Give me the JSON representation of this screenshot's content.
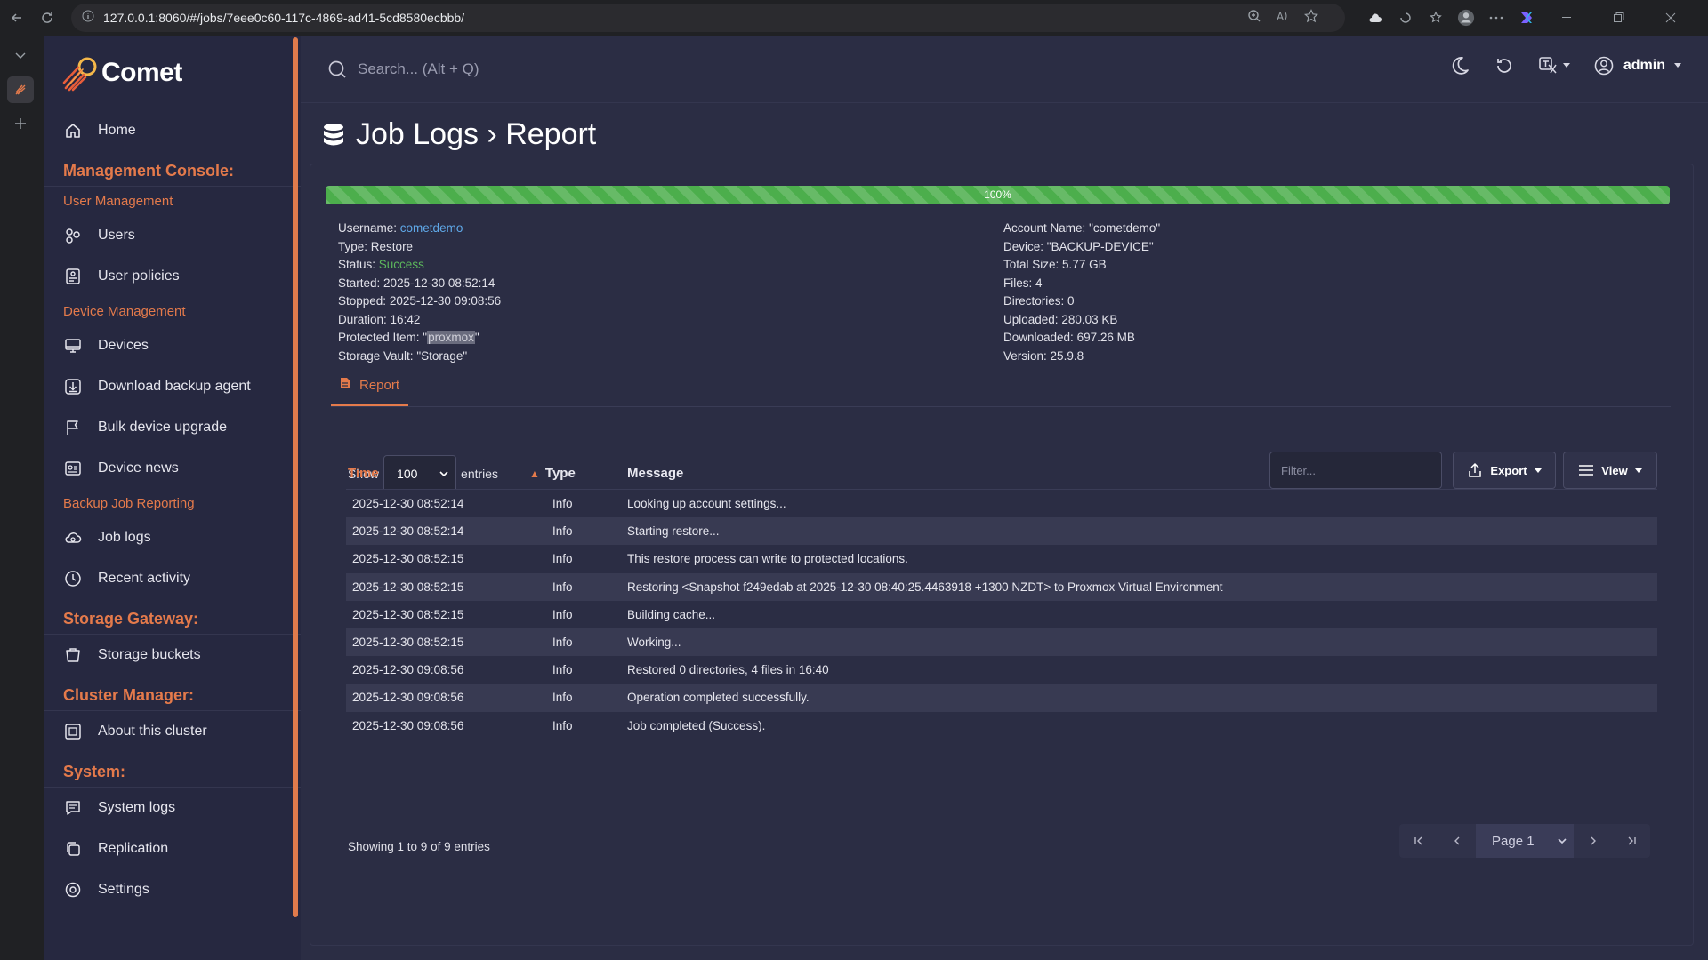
{
  "browser": {
    "url": "127.0.0.1:8060/#/jobs/7eee0c60-117c-4869-ad41-5cd8580ecbbb/"
  },
  "brand": {
    "name": "Comet"
  },
  "sidebar": {
    "home": "Home",
    "management_console": "Management Console:",
    "user_management": "User Management",
    "users": "Users",
    "user_policies": "User policies",
    "device_management": "Device Management",
    "devices": "Devices",
    "download_backup_agent": "Download backup agent",
    "bulk_device_upgrade": "Bulk device upgrade",
    "device_news": "Device news",
    "backup_job_reporting": "Backup Job Reporting",
    "job_logs": "Job logs",
    "recent_activity": "Recent activity",
    "storage_gateway": "Storage Gateway:",
    "storage_buckets": "Storage buckets",
    "cluster_manager": "Cluster Manager:",
    "about_cluster": "About this cluster",
    "system": "System:",
    "system_logs": "System logs",
    "replication": "Replication",
    "settings": "Settings"
  },
  "topbar": {
    "search_placeholder": "Search... (Alt + Q)",
    "user": "admin"
  },
  "page": {
    "title": "Job Logs › Report"
  },
  "progress": {
    "value": 1.0,
    "label": "100%"
  },
  "job": {
    "username_label": "Username:",
    "username": "cometdemo",
    "type_label": "Type:",
    "type": "Restore",
    "status_label": "Status:",
    "status": "Success",
    "started_label": "Started:",
    "started": "2025-12-30 08:52:14",
    "stopped_label": "Stopped:",
    "stopped": "2025-12-30 09:08:56",
    "duration_label": "Duration:",
    "duration": "16:42",
    "protected_item_label": "Protected Item:",
    "protected_item": "proxmox",
    "storage_vault_label": "Storage Vault:",
    "storage_vault": "\"Storage\"",
    "account_name_label": "Account Name:",
    "account_name": "\"cometdemo\"",
    "device_label": "Device:",
    "device": "\"BACKUP-DEVICE\"",
    "total_size_label": "Total Size:",
    "total_size": "5.77 GB",
    "files_label": "Files:",
    "files": "4",
    "directories_label": "Directories:",
    "directories": "0",
    "uploaded_label": "Uploaded:",
    "uploaded": "280.03 KB",
    "downloaded_label": "Downloaded:",
    "downloaded": "697.26 MB",
    "version_label": "Version:",
    "version": "25.9.8"
  },
  "tabs": {
    "report": "Report"
  },
  "table_controls": {
    "show": "Show",
    "page_size": "100",
    "entries": "entries",
    "filter_placeholder": "Filter...",
    "export": "Export",
    "view": "View"
  },
  "table": {
    "columns": [
      "Time",
      "Type",
      "Message"
    ],
    "rows": [
      [
        "2025-12-30 08:52:14",
        "Info",
        "Looking up account settings..."
      ],
      [
        "2025-12-30 08:52:14",
        "Info",
        "Starting restore..."
      ],
      [
        "2025-12-30 08:52:15",
        "Info",
        "This restore process can write to protected locations."
      ],
      [
        "2025-12-30 08:52:15",
        "Info",
        "Restoring <Snapshot f249edab at 2025-12-30 08:40:25.4463918 +1300 NZDT> to Proxmox Virtual Environment"
      ],
      [
        "2025-12-30 08:52:15",
        "Info",
        "Building cache..."
      ],
      [
        "2025-12-30 08:52:15",
        "Info",
        "Working..."
      ],
      [
        "2025-12-30 09:08:56",
        "Info",
        "Restored 0 directories, 4 files in 16:40"
      ],
      [
        "2025-12-30 09:08:56",
        "Info",
        "Operation completed successfully."
      ],
      [
        "2025-12-30 09:08:56",
        "Info",
        "Job completed (Success)."
      ]
    ]
  },
  "footer": {
    "showing": "Showing 1 to 9 of 9 entries",
    "page": "Page 1"
  },
  "colors": {
    "accent": "#e47a4b",
    "success": "#5cb85c",
    "link": "#5fa8e8",
    "background": "#2b2d44",
    "sidebar": "#262840"
  }
}
